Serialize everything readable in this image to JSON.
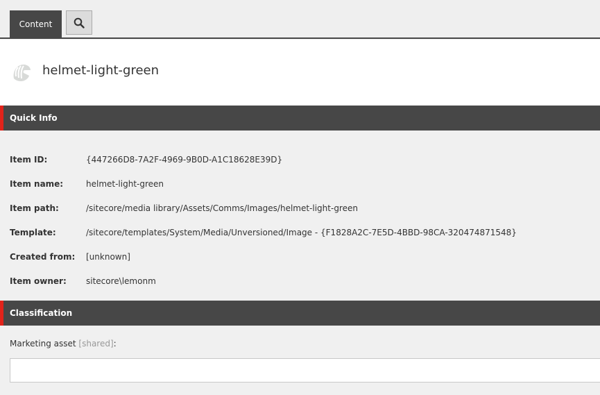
{
  "tabs": {
    "content_label": "Content",
    "search_icon": "search-icon"
  },
  "header": {
    "icon": "helmet-icon",
    "title": "helmet-light-green"
  },
  "quick_info": {
    "title": "Quick Info",
    "rows": [
      {
        "label": "Item ID:",
        "value": "{447266D8-7A2F-4969-9B0D-A1C18628E39D}"
      },
      {
        "label": "Item name:",
        "value": "helmet-light-green"
      },
      {
        "label": "Item path:",
        "value": "/sitecore/media library/Assets/Comms/Images/helmet-light-green"
      },
      {
        "label": "Template:",
        "value": "/sitecore/templates/System/Media/Unversioned/Image - {F1828A2C-7E5D-4BBD-98CA-320474871548}"
      },
      {
        "label": "Created from:",
        "value": "[unknown]"
      },
      {
        "label": "Item owner:",
        "value": "sitecore\\lemonm"
      }
    ]
  },
  "classification": {
    "title": "Classification",
    "field_label": "Marketing asset",
    "field_shared": "[shared]",
    "field_colon": ":",
    "field_value": ""
  },
  "colors": {
    "tab_dark": "#474747",
    "accent_red": "#e2231a",
    "background": "#f0f0f0"
  }
}
